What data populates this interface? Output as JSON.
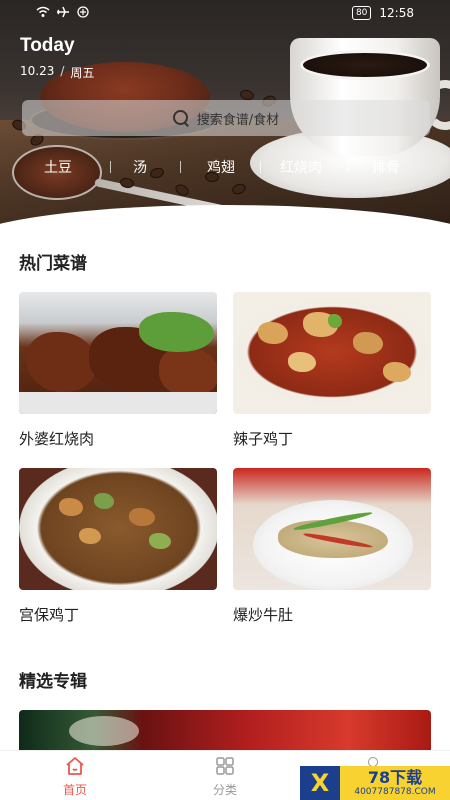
{
  "status_bar": {
    "left_icons": [
      "wifi-icon",
      "airplane-icon",
      "signal-icon"
    ],
    "battery": "80",
    "time": "12:58"
  },
  "header": {
    "title": "Today",
    "date": "10.23",
    "weekday": "周五",
    "date_separator": "/"
  },
  "search": {
    "placeholder": "搜索食谱/食材"
  },
  "categories": [
    "土豆",
    "汤",
    "鸡翅",
    "红烧肉",
    "排骨"
  ],
  "hot_recipes": {
    "title": "热门菜谱",
    "items": [
      {
        "name": "外婆红烧肉"
      },
      {
        "name": "辣子鸡丁"
      },
      {
        "name": "宫保鸡丁"
      },
      {
        "name": "爆炒牛肚"
      }
    ]
  },
  "featured": {
    "title": "精选专辑"
  },
  "bottom_nav": {
    "items": [
      {
        "label": "首页",
        "active": true
      },
      {
        "label": "分类",
        "active": false
      }
    ]
  },
  "watermark": {
    "brand": "78下载",
    "url": "4007787878.COM"
  },
  "colors": {
    "accent": "#e85a4f",
    "inactive": "#999999",
    "text": "#222222"
  }
}
